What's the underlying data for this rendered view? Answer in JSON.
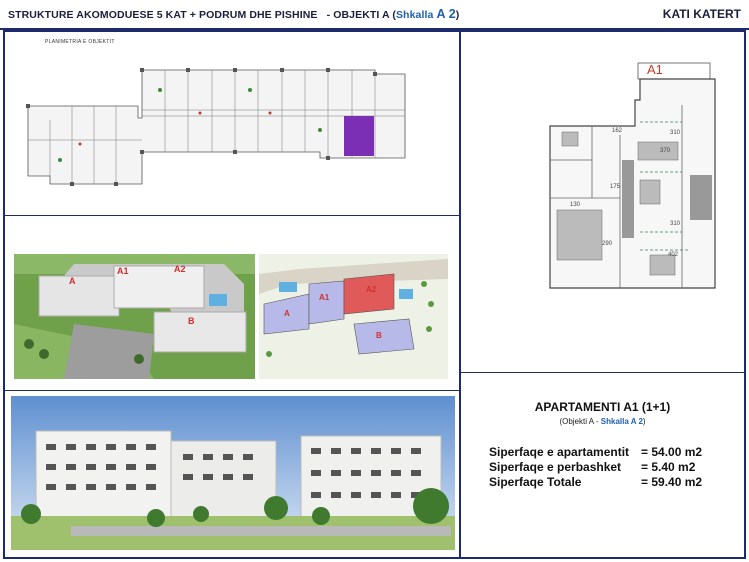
{
  "header": {
    "title_main": "STRUKTURE AKOMODUESE 5 KAT + PODRUM DHE PISHINE",
    "title_object": "- OBJEKTI A (",
    "title_shkalla": "Shkalla",
    "title_a2": "A 2",
    "title_close": ")",
    "floor_label": "KATI KATERT"
  },
  "floorplan": {
    "label": "PLANIMETRIA E OBJEKTIT"
  },
  "unit_plan": {
    "label": "A1",
    "dims": [
      "162",
      "310",
      "370",
      "310",
      "402",
      "130",
      "175",
      "290"
    ]
  },
  "site_views": {
    "aerial_labels": [
      "A",
      "A1",
      "A2",
      "B"
    ],
    "site_labels": [
      "A",
      "A1",
      "A2",
      "B"
    ]
  },
  "apartment": {
    "title": "APARTAMENTI A1 (1+1)",
    "sub_prefix": "(Objekti A - ",
    "sub_shkalla": "Shkalla A 2",
    "sub_suffix": ")",
    "rows": [
      {
        "label": "Siperfaqe e apartamentit",
        "value": "= 54.00 m2"
      },
      {
        "label": "Siperfaqe e perbashket",
        "value": "=  5.40 m2"
      },
      {
        "label": "Siperfaqe Totale",
        "value": "= 59.40 m2"
      }
    ]
  },
  "colors": {
    "frame": "#1d2a6b",
    "accent_blue": "#1f5fb0",
    "highlight_unit": "#7b2fb5",
    "label_red": "#c0392b"
  }
}
